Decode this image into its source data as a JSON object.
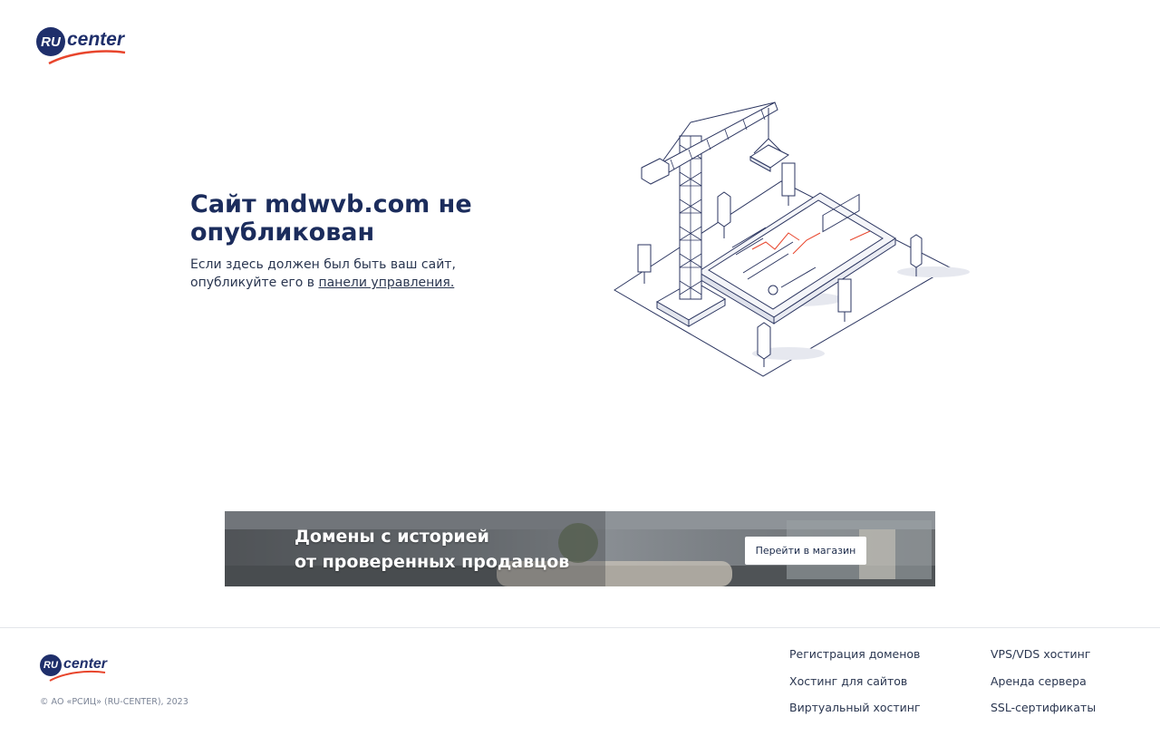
{
  "header": {
    "logo": {
      "badge": "RU",
      "word": "center"
    }
  },
  "main": {
    "title": "Сайт mdwvb.com не опубликован",
    "text_before_link": "Если здесь должен был быть ваш сайт, опубликуйте его в ",
    "link_text": "панели управления.",
    "illustration_icon": "construction-crane-illustration"
  },
  "banner": {
    "line1": "Домены с историей",
    "line2": "от проверенных продавцов",
    "button": "Перейти в магазин"
  },
  "footer": {
    "logo": {
      "badge": "RU",
      "word": "center"
    },
    "copyright": "© АО «РСИЦ» (RU-CENTER), 2023",
    "col1": [
      "Регистрация доменов",
      "Хостинг для сайтов",
      "Виртуальный хостинг"
    ],
    "col2": [
      "VPS/VDS хостинг",
      "Аренда сервера",
      "SSL-сертификаты"
    ]
  },
  "colors": {
    "brand_navy": "#1f2f6b",
    "brand_red": "#e8452c",
    "heading": "#1b2c5c"
  }
}
